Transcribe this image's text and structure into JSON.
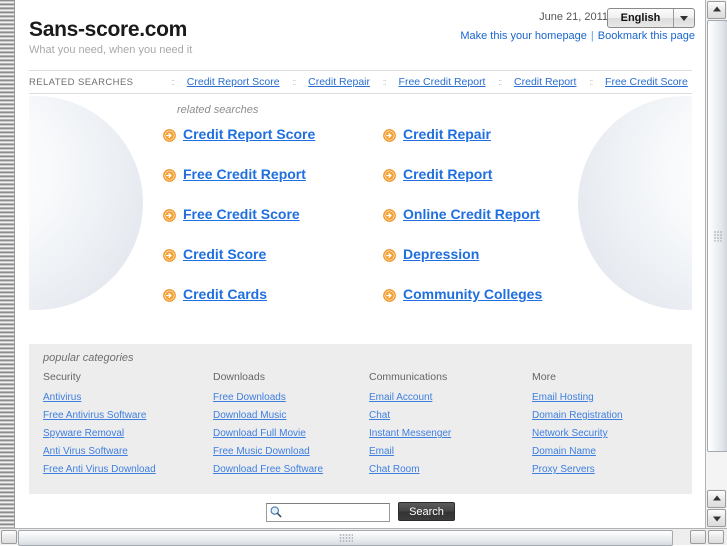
{
  "header": {
    "site_title": "Sans-score.com",
    "tagline": "What you need, when you need it",
    "date": "June 21, 2011",
    "language": "English",
    "homepage_link": "Make this your homepage",
    "bookmark_link": "Bookmark this page",
    "link_separator": "|"
  },
  "related_bar": {
    "label": "RELATED SEARCHES",
    "separator": "::",
    "items": [
      "Credit Report Score",
      "Credit Repair",
      "Free Credit Report",
      "Credit Report",
      "Free Credit Score"
    ]
  },
  "hero": {
    "label": "related searches",
    "links_left": [
      "Credit Report Score",
      "Free Credit Report",
      "Free Credit Score",
      "Credit Score",
      "Credit Cards"
    ],
    "links_right": [
      "Credit Repair",
      "Credit Report",
      "Online Credit Report",
      "Depression",
      "Community Colleges"
    ]
  },
  "categories": {
    "title": "popular categories",
    "columns": [
      {
        "heading": "Security",
        "links": [
          "Antivirus",
          "Free Antivirus Software",
          "Spyware Removal",
          "Anti Virus Software",
          "Free Anti Virus Download"
        ]
      },
      {
        "heading": "Downloads",
        "links": [
          "Free Downloads",
          "Download Music",
          "Download Full Movie",
          "Free Music Download",
          "Download Free Software"
        ]
      },
      {
        "heading": "Communications",
        "links": [
          "Email Account",
          "Chat",
          "Instant Messenger",
          "Email",
          "Chat Room"
        ]
      },
      {
        "heading": "More",
        "links": [
          "Email Hosting",
          "Domain Registration",
          "Network Security",
          "Domain Name",
          "Proxy Servers"
        ]
      }
    ]
  },
  "search": {
    "value": "",
    "placeholder": "",
    "button_label": "Search",
    "icon": "magnifier-icon"
  },
  "colors": {
    "link_blue": "#1f6fe0",
    "arrow_orange": "#f08a1e",
    "category_bg": "#ededed",
    "search_button_bg": "#3c3c3c"
  },
  "icons": {
    "arrow_bullet": "circle-arrow-right-icon",
    "dropdown": "chevron-down-icon",
    "search": "magnifier-icon"
  }
}
